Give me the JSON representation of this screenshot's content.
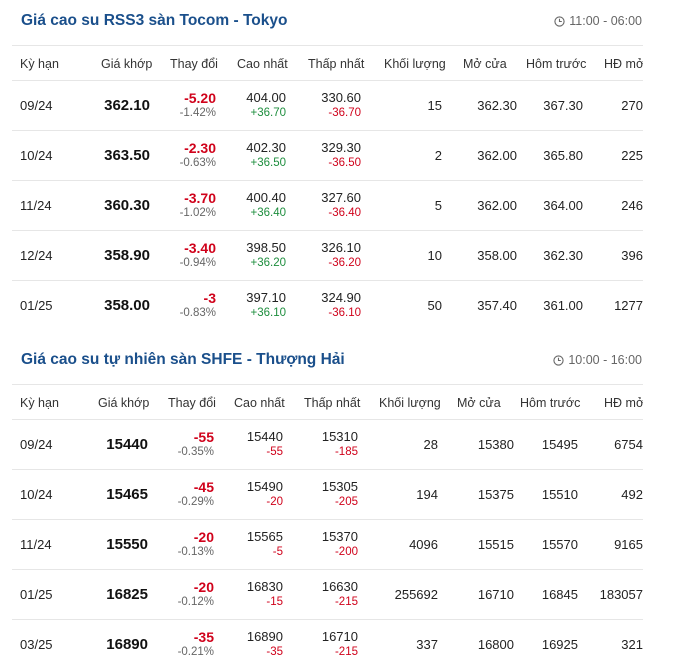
{
  "sections": [
    {
      "title": "Giá cao su RSS3 sàn Tocom - Tokyo",
      "time": "11:00 - 06:00",
      "columns": [
        "Kỳ hạn",
        "Giá khớp",
        "Thay đổi",
        "Cao nhất",
        "Thấp nhất",
        "Khối lượng",
        "Mở cửa",
        "Hôm trước",
        "HĐ mở"
      ],
      "rows": [
        {
          "term": "09/24",
          "price": "362.10",
          "change": "-5.20",
          "change_pct": "-1.42%",
          "high": "404.00",
          "high_diff": "+36.70",
          "low": "330.60",
          "low_diff": "-36.70",
          "volume": "15",
          "open": "362.30",
          "prev": "367.30",
          "oi": "270"
        },
        {
          "term": "10/24",
          "price": "363.50",
          "change": "-2.30",
          "change_pct": "-0.63%",
          "high": "402.30",
          "high_diff": "+36.50",
          "low": "329.30",
          "low_diff": "-36.50",
          "volume": "2",
          "open": "362.00",
          "prev": "365.80",
          "oi": "225"
        },
        {
          "term": "11/24",
          "price": "360.30",
          "change": "-3.70",
          "change_pct": "-1.02%",
          "high": "400.40",
          "high_diff": "+36.40",
          "low": "327.60",
          "low_diff": "-36.40",
          "volume": "5",
          "open": "362.00",
          "prev": "364.00",
          "oi": "246"
        },
        {
          "term": "12/24",
          "price": "358.90",
          "change": "-3.40",
          "change_pct": "-0.94%",
          "high": "398.50",
          "high_diff": "+36.20",
          "low": "326.10",
          "low_diff": "-36.20",
          "volume": "10",
          "open": "358.00",
          "prev": "362.30",
          "oi": "396"
        },
        {
          "term": "01/25",
          "price": "358.00",
          "change": "-3",
          "change_pct": "-0.83%",
          "high": "397.10",
          "high_diff": "+36.10",
          "low": "324.90",
          "low_diff": "-36.10",
          "volume": "50",
          "open": "357.40",
          "prev": "361.00",
          "oi": "1277"
        }
      ]
    },
    {
      "title": "Giá cao su tự nhiên sàn SHFE - Thượng Hải",
      "time": "10:00 - 16:00",
      "columns": [
        "Kỳ hạn",
        "Giá khớp",
        "Thay đổi",
        "Cao nhất",
        "Thấp nhất",
        "Khối lượng",
        "Mở cửa",
        "Hôm trước",
        "HĐ mở"
      ],
      "rows": [
        {
          "term": "09/24",
          "price": "15440",
          "change": "-55",
          "change_pct": "-0.35%",
          "high": "15440",
          "high_diff": "-55",
          "low": "15310",
          "low_diff": "-185",
          "volume": "28",
          "open": "15380",
          "prev": "15495",
          "oi": "6754"
        },
        {
          "term": "10/24",
          "price": "15465",
          "change": "-45",
          "change_pct": "-0.29%",
          "high": "15490",
          "high_diff": "-20",
          "low": "15305",
          "low_diff": "-205",
          "volume": "194",
          "open": "15375",
          "prev": "15510",
          "oi": "492"
        },
        {
          "term": "11/24",
          "price": "15550",
          "change": "-20",
          "change_pct": "-0.13%",
          "high": "15565",
          "high_diff": "-5",
          "low": "15370",
          "low_diff": "-200",
          "volume": "4096",
          "open": "15515",
          "prev": "15570",
          "oi": "9165"
        },
        {
          "term": "01/25",
          "price": "16825",
          "change": "-20",
          "change_pct": "-0.12%",
          "high": "16830",
          "high_diff": "-15",
          "low": "16630",
          "low_diff": "-215",
          "volume": "255692",
          "open": "16710",
          "prev": "16845",
          "oi": "183057"
        },
        {
          "term": "03/25",
          "price": "16890",
          "change": "-35",
          "change_pct": "-0.21%",
          "high": "16890",
          "high_diff": "-35",
          "low": "16710",
          "low_diff": "-215",
          "volume": "337",
          "open": "16800",
          "prev": "16925",
          "oi": "321"
        }
      ]
    }
  ],
  "colors": {
    "title": "#1a4f8b",
    "down": "#d0021b",
    "up": "#1e8e3e"
  },
  "icons": {
    "time": "clock-icon"
  }
}
